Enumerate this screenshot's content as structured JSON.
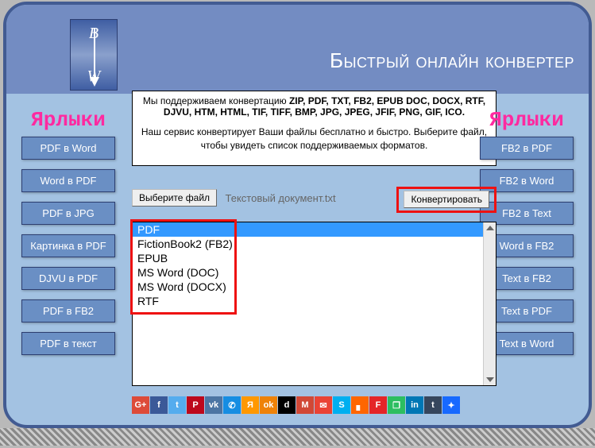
{
  "logo": {
    "top": "B",
    "bottom": "W"
  },
  "site_title": "Быстрый онлайн конвертер",
  "info": {
    "line1_prefix": "Мы поддерживаем конвертацию ",
    "line1_formats": "ZIP, PDF, TXT, FB2, EPUB DOC, DOCX, RTF, DJVU, HTM, HTML, TIF, TIFF, BMP, JPG, JPEG, JFIF, PNG, GIF, ICO.",
    "line2": "Наш сервис конвертирует Ваши файлы бесплатно и быстро. Выберите файл, чтобы увидеть список поддерживаемых форматов."
  },
  "sidebar_title": "Ярлыки",
  "left_links": [
    "PDF в Word",
    "Word в PDF",
    "PDF в JPG",
    "Картинка в PDF",
    "DJVU в PDF",
    "PDF в FB2",
    "PDF в текст"
  ],
  "right_links": [
    "FB2 в PDF",
    "FB2 в Word",
    "FB2 в Text",
    "Word в FB2",
    "Text в FB2",
    "Text в PDF",
    "Text в Word"
  ],
  "controls": {
    "choose_file": "Выберите файл",
    "filename": "Текстовый документ.txt",
    "convert": "Конвертировать"
  },
  "formats": [
    "PDF",
    "FictionBook2 (FB2)",
    "EPUB",
    "MS Word (DOC)",
    "MS Word (DOCX)",
    "RTF"
  ],
  "selected_format_index": 0,
  "share_icons": [
    {
      "bg": "#dd4b39",
      "txt": "G+"
    },
    {
      "bg": "#3b5998",
      "txt": "f"
    },
    {
      "bg": "#55acee",
      "txt": "t"
    },
    {
      "bg": "#bd081c",
      "txt": "P"
    },
    {
      "bg": "#4c75a3",
      "txt": "vk"
    },
    {
      "bg": "#168de2",
      "txt": "✆"
    },
    {
      "bg": "#ff9800",
      "txt": "Я"
    },
    {
      "bg": "#ee8208",
      "txt": "ok"
    },
    {
      "bg": "#000000",
      "txt": "d"
    },
    {
      "bg": "#d14836",
      "txt": "M"
    },
    {
      "bg": "#ea4335",
      "txt": "✉"
    },
    {
      "bg": "#00aff0",
      "txt": "S"
    },
    {
      "bg": "#ff6600",
      "txt": "▖"
    },
    {
      "bg": "#e42528",
      "txt": "F"
    },
    {
      "bg": "#2dbe60",
      "txt": "❐"
    },
    {
      "bg": "#0077b5",
      "txt": "in"
    },
    {
      "bg": "#36465d",
      "txt": "t"
    },
    {
      "bg": "#1769ff",
      "txt": "✦"
    }
  ]
}
